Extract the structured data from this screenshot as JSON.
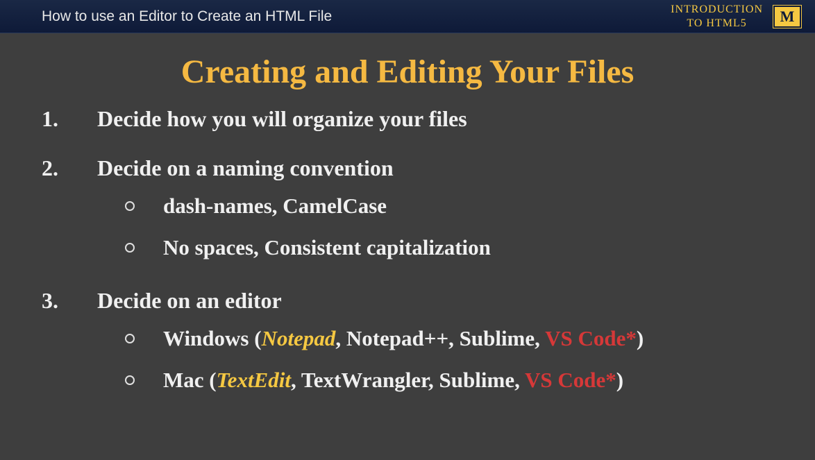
{
  "header": {
    "title": "How to use an Editor to Create an HTML File",
    "course_line1": "INTRODUCTION",
    "course_line2": "TO HTML5",
    "logo": "M"
  },
  "slide": {
    "title": "Creating and Editing Your Files",
    "items": [
      {
        "number": "1.",
        "text": "Decide how you will organize your files",
        "subitems": []
      },
      {
        "number": "2.",
        "text": "Decide on a naming convention",
        "subitems": [
          {
            "segments": [
              {
                "text": "dash-names, CamelCase",
                "style": "normal"
              }
            ]
          },
          {
            "segments": [
              {
                "text": "No spaces, Consistent capitalization",
                "style": "normal"
              }
            ]
          }
        ]
      },
      {
        "number": "3.",
        "text": "Decide on an editor",
        "subitems": [
          {
            "segments": [
              {
                "text": "Windows (",
                "style": "normal"
              },
              {
                "text": "Notepad",
                "style": "italic-yellow"
              },
              {
                "text": ", Notepad++, Sublime, ",
                "style": "normal"
              },
              {
                "text": "VS Code*",
                "style": "red"
              },
              {
                "text": ")",
                "style": "normal"
              }
            ]
          },
          {
            "segments": [
              {
                "text": "Mac (",
                "style": "normal"
              },
              {
                "text": "TextEdit",
                "style": "italic-yellow"
              },
              {
                "text": ", TextWrangler, Sublime, ",
                "style": "normal"
              },
              {
                "text": "VS Code*",
                "style": "red"
              },
              {
                "text": ")",
                "style": "normal"
              }
            ]
          }
        ]
      }
    ]
  }
}
